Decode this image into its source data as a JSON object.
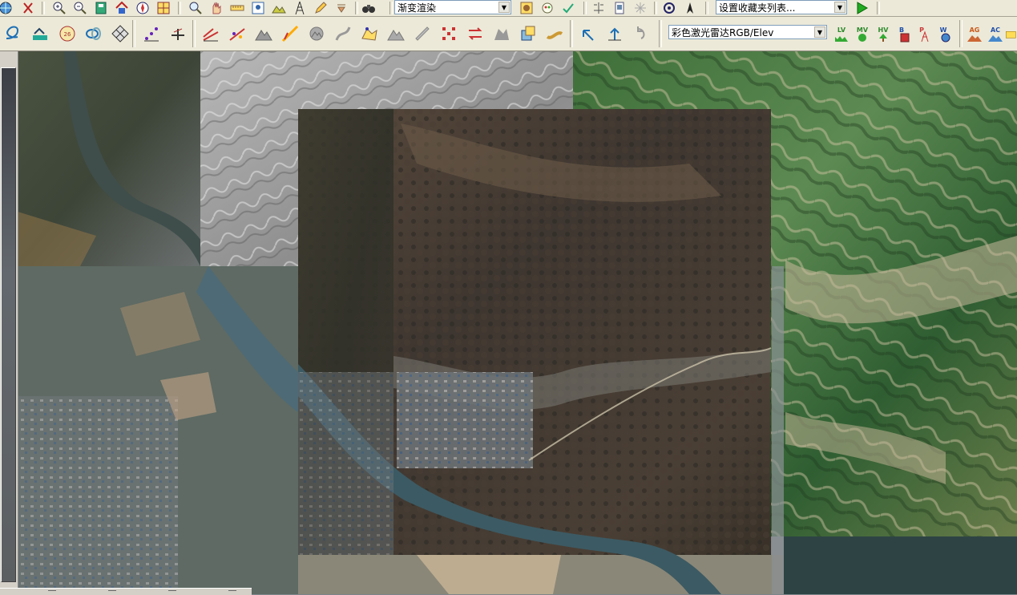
{
  "toolbar_top": {
    "render_mode_combo": {
      "value": "渐变渲染"
    },
    "favorites_combo": {
      "value": "设置收藏夹列表..."
    },
    "icons": [
      "globe-icon",
      "scissors-icon",
      "zoom-in-icon",
      "zoom-out-icon",
      "save-layer-icon",
      "home-icon",
      "compass-icon",
      "grid-layers-icon",
      "magnifier-icon",
      "hand-icon",
      "ruler-icon",
      "query-icon",
      "terrain-icon",
      "tower-icon",
      "pencil-icon",
      "arrow-down-icon",
      "binoculars-icon",
      "wand-icon",
      "paint-icon",
      "layers-check-icon",
      "mirror-icon",
      "document-icon",
      "sparkle-icon",
      "target-icon",
      "north-arrow-icon",
      "play-icon"
    ]
  },
  "toolbar_bottom": {
    "lidar_combo": {
      "value": "彩色激光雷达RGB/Elev"
    },
    "label_buttons": [
      {
        "label": "LV",
        "color": "#2c8a2c"
      },
      {
        "label": "MV",
        "color": "#2c8a2c"
      },
      {
        "label": "HV",
        "color": "#2c8a2c"
      },
      {
        "label": "B",
        "color": "#1f4fa8"
      },
      {
        "label": "P",
        "color": "#c83a3a"
      },
      {
        "label": "W",
        "color": "#1f4fa8"
      },
      {
        "label": "AG",
        "color": "#c85a1a"
      },
      {
        "label": "AC",
        "color": "#1f4fa8"
      }
    ]
  },
  "colors": {
    "toolbar_bg": "#ece9d8",
    "panel_bg": "#d4d0c8",
    "play_green": "#22aa22"
  }
}
